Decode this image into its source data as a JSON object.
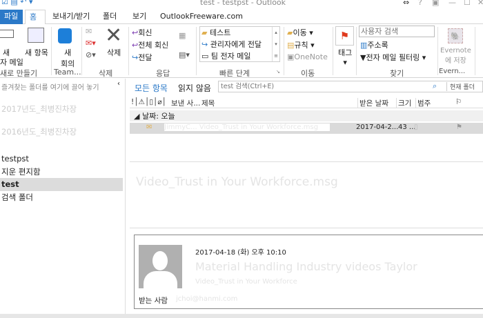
{
  "window": {
    "title": "test - testpst - Outlook",
    "help": "?",
    "controls": [
      "⇔",
      "?",
      "▣",
      "—",
      "☐",
      "✕"
    ]
  },
  "tabs": {
    "file": "파일",
    "home": "홈",
    "send_receive": "보내기/받기",
    "folder": "폴더",
    "view": "보기",
    "addin": "OutlookFreeware.com"
  },
  "ribbon": {
    "new_group": {
      "label": "새로 만들기",
      "new_mail": [
        "새",
        "자 메일"
      ],
      "new_items": "새 항목"
    },
    "teamviewer": {
      "label": "Team...",
      "meeting": [
        "새",
        "회의"
      ]
    },
    "delete_group": {
      "label": "삭제",
      "delete": "삭제"
    },
    "respond": {
      "label": "응답",
      "reply": "회신",
      "reply_all": "전체 회신",
      "forward": "전달"
    },
    "quick_steps": {
      "label": "빠른 단계",
      "items": [
        "테스트",
        "관리자에게 전달",
        "팀 전자 메일"
      ]
    },
    "move": {
      "label": "이동",
      "move": "이동",
      "rules": "규칙",
      "onenote": "OneNote"
    },
    "tags": {
      "label": "태그"
    },
    "find": {
      "label": "찾기",
      "search_people_placeholder": "사용자 검색",
      "address_book": "주소록",
      "filter_email": "전자 메일 필터링"
    },
    "evernote": {
      "label": "Evern...",
      "save": [
        "Evernote",
        "에 저장"
      ]
    }
  },
  "folder_pane": {
    "favorites_hint": "즐겨찾는 폴더를 여기에 끌어 놓기",
    "items": [
      "2017년도_최병진차장",
      "2016년도_최병진차장",
      "testpst",
      "지운 편지함",
      "test",
      "검색 폴더"
    ],
    "selected": "test"
  },
  "filter": {
    "all": "모든 항목",
    "unread": "읽지 않음",
    "search_placeholder": "test 검색(Ctrl+E)",
    "scope": "현재 폴더"
  },
  "columns": {
    "icons": "!",
    "from": "보낸 사...",
    "subject": "제목",
    "received": "받은 날짜",
    "size": "크기",
    "category": "범주"
  },
  "group": "날짜: 오늘",
  "message": {
    "from": "JimmyC...",
    "subject": "Video_Trust in Your Workforce.msg",
    "received": "2017-04-2...",
    "size": "43 ..."
  },
  "reading": {
    "file_title": "Video_Trust in Your Workforce.msg",
    "file_suffix": ".msg",
    "datetime": "2017-04-18 (화) 오후 10:10",
    "subject": "Material Handling Industry videos Taylor",
    "subtitle": "Video_Trust in Your Workforce",
    "to_label": "받는 사람",
    "to": "jchoi@hanmi.com"
  }
}
